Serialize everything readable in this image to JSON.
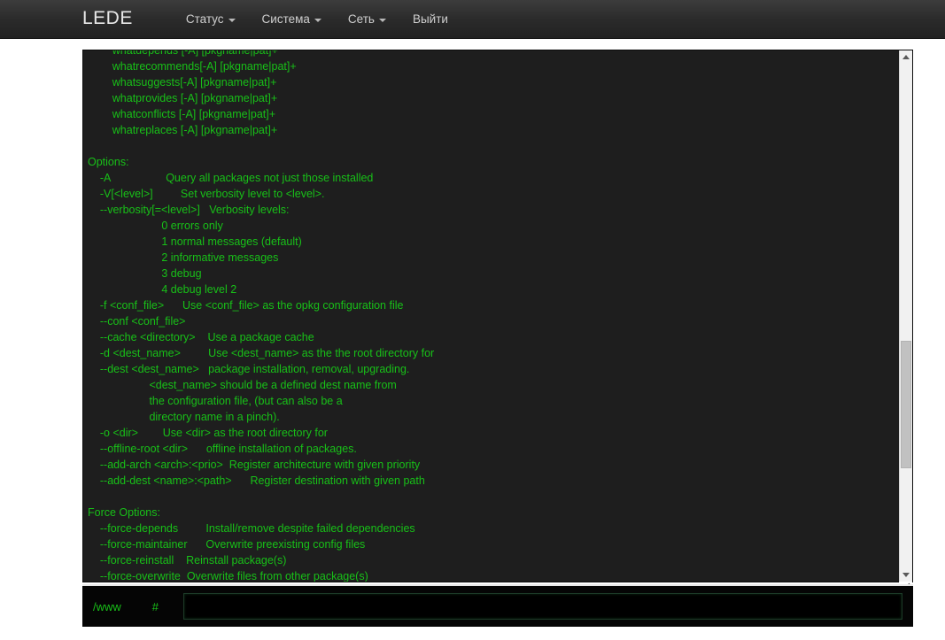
{
  "navbar": {
    "brand": "LEDE",
    "items": [
      {
        "label": "Статус",
        "has_caret": true
      },
      {
        "label": "Система",
        "has_caret": true
      },
      {
        "label": "Сеть",
        "has_caret": true
      },
      {
        "label": "Выйти",
        "has_caret": false
      }
    ]
  },
  "colors": {
    "terminal_bg": "#1e1e1e",
    "terminal_fg": "#18c018",
    "navbar_bg": "#2b2b2b",
    "page_bg": "#ffffff",
    "scrollbar_track": "#f1f1f1",
    "scrollbar_thumb": "#c1c1c1"
  },
  "terminal": {
    "lines": [
      "        whatdepends [-A] [pkgname|pat]+",
      "        whatrecommends[-A] [pkgname|pat]+",
      "        whatsuggests[-A] [pkgname|pat]+",
      "        whatprovides [-A] [pkgname|pat]+",
      "        whatconflicts [-A] [pkgname|pat]+",
      "        whatreplaces [-A] [pkgname|pat]+",
      "",
      "Options:",
      "    -A                  Query all packages not just those installed",
      "    -V[<level>]         Set verbosity level to <level>.",
      "    --verbosity[=<level>]   Verbosity levels:",
      "                        0 errors only",
      "                        1 normal messages (default)",
      "                        2 informative messages",
      "                        3 debug",
      "                        4 debug level 2",
      "    -f <conf_file>      Use <conf_file> as the opkg configuration file",
      "    --conf <conf_file>",
      "    --cache <directory>    Use a package cache",
      "    -d <dest_name>         Use <dest_name> as the the root directory for",
      "    --dest <dest_name>   package installation, removal, upgrading.",
      "                    <dest_name> should be a defined dest name from",
      "                    the configuration file, (but can also be a",
      "                    directory name in a pinch).",
      "    -o <dir>        Use <dir> as the root directory for",
      "    --offline-root <dir>      offline installation of packages.",
      "    --add-arch <arch>:<prio>  Register architecture with given priority",
      "    --add-dest <name>:<path>      Register destination with given path",
      "",
      "Force Options:",
      "    --force-depends         Install/remove despite failed dependencies",
      "    --force-maintainer      Overwrite preexisting config files",
      "    --force-reinstall    Reinstall package(s)",
      "    --force-overwrite  Overwrite files from other package(s)"
    ]
  },
  "scrollbar": {
    "up_arrow": "scroll-up",
    "down_arrow": "scroll-down"
  },
  "prompt": {
    "cwd": "/www",
    "symbol": "#",
    "command_value": "",
    "placeholder": ""
  }
}
